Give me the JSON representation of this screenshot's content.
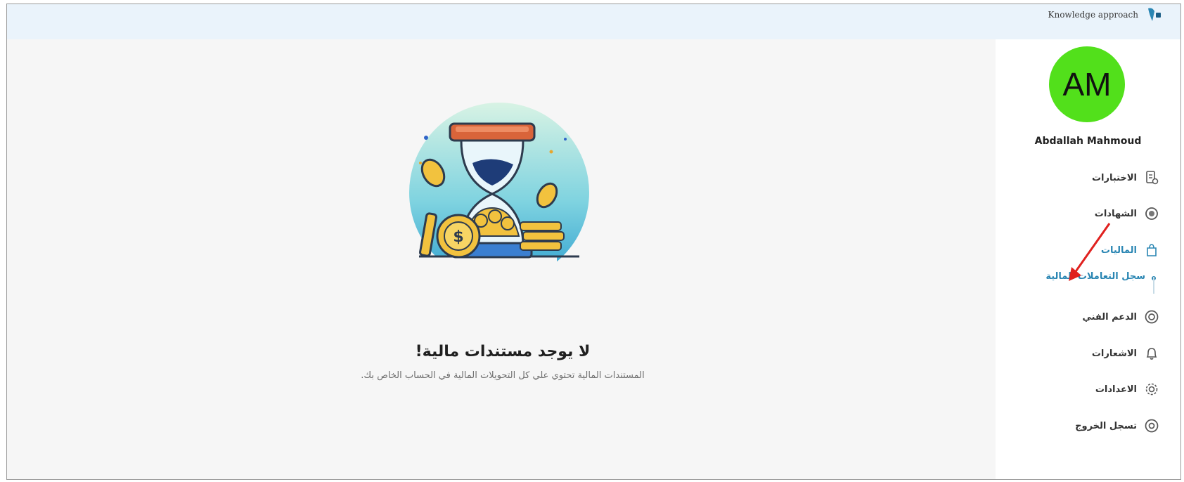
{
  "header": {
    "brand_text": "Knowledge approach",
    "brand_icon": "knowledge-logo-icon"
  },
  "empty_state": {
    "title": "لا يوجد مستندات مالية!",
    "subtitle": "المستندات المالية تحتوي علي كل التحويلات المالية في الحساب الخاص بك.",
    "illustration": "hourglass-coins-illustration"
  },
  "sidebar": {
    "avatar_initials": "AM",
    "avatar_color": "#52e01b",
    "user_name": "Abdallah Mahmoud",
    "items": [
      {
        "label": "الاختبارات",
        "icon": "exams-icon"
      },
      {
        "label": "الشهادات",
        "icon": "certificate-icon"
      },
      {
        "label": "الماليات",
        "icon": "wallet-icon"
      },
      {
        "label": "سجل التعاملات المالية",
        "icon": "sub-dot"
      },
      {
        "label": "الدعم الفني",
        "icon": "lifebuoy-icon"
      },
      {
        "label": "الاشعارات",
        "icon": "bell-icon"
      },
      {
        "label": "الاعدادات",
        "icon": "gear-icon"
      },
      {
        "label": "تسجل الخروج",
        "icon": "logout-icon"
      }
    ]
  },
  "colors": {
    "accent": "#2a86b3",
    "topbar": "#eaf3fb",
    "annotation_arrow": "#e0201e"
  }
}
